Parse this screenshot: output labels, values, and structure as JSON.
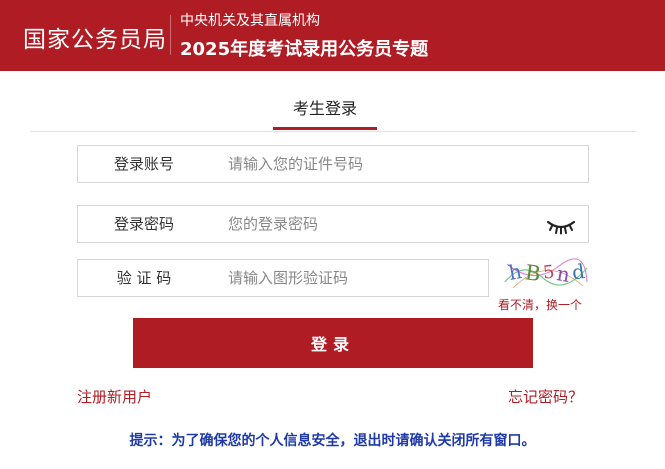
{
  "header": {
    "brand": "国家公务员局",
    "subtitle_1": "中央机关及其直属机构",
    "subtitle_2": "2025年度考试录用公务员专题"
  },
  "tab": {
    "label": "考生登录"
  },
  "form": {
    "account": {
      "label": "登录账号",
      "placeholder": "请输入您的证件号码",
      "value": ""
    },
    "password": {
      "label": "登录密码",
      "placeholder": "您的登录密码",
      "value": ""
    },
    "captcha": {
      "label": "验 证 码",
      "placeholder": "请输入图形验证码",
      "value": "",
      "image_text": "hB5nd",
      "refresh_label": "看不清，换一个"
    },
    "submit_label": "登录"
  },
  "links": {
    "register": "注册新用户",
    "forgot": "忘记密码？"
  },
  "tip": "提示：为了确保您的个人信息安全，退出时请确认关闭所有窗口。",
  "colors": {
    "brand_red": "#b01c24",
    "tip_blue": "#1f3aa8"
  },
  "icons": {
    "password_toggle": "eye-closed-icon"
  }
}
